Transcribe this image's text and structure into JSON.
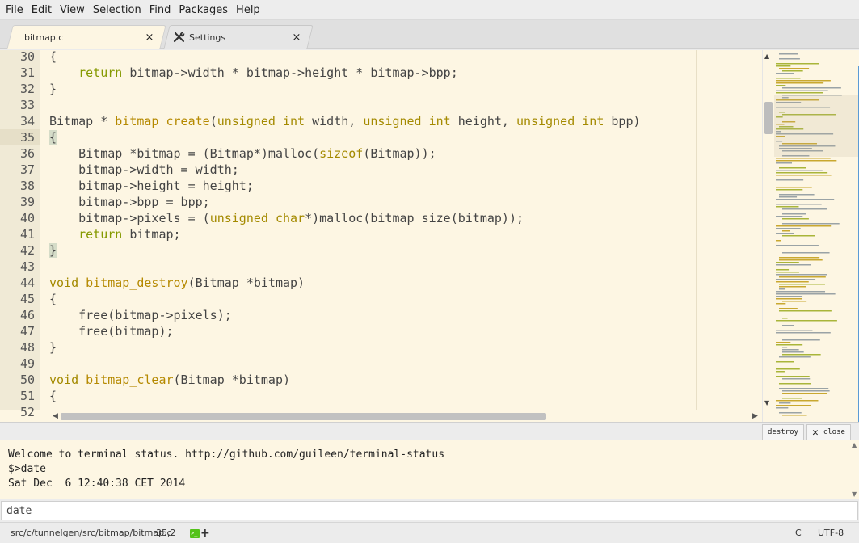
{
  "menu": [
    "File",
    "Edit",
    "View",
    "Selection",
    "Find",
    "Packages",
    "Help"
  ],
  "tabs": [
    {
      "label": "bitmap.c",
      "close": "×"
    },
    {
      "label": "Settings",
      "close": "×"
    }
  ],
  "gutter": {
    "lines": [
      "30",
      "31",
      "32",
      "33",
      "34",
      "35",
      "36",
      "37",
      "38",
      "39",
      "40",
      "41",
      "42",
      "43",
      "44",
      "45",
      "46",
      "47",
      "48",
      "49",
      "50",
      "51",
      "52"
    ],
    "current": "35"
  },
  "code": [
    [
      [
        "p",
        "{"
      ]
    ],
    [
      [
        "p",
        "    "
      ],
      [
        "kw",
        "return"
      ],
      [
        "p",
        " bitmap->width * bitmap->height * bitmap->bpp;"
      ]
    ],
    [
      [
        "p",
        "}"
      ]
    ],
    [
      [
        "p",
        ""
      ]
    ],
    [
      [
        "p",
        "Bitmap * "
      ],
      [
        "fn",
        "bitmap_create"
      ],
      [
        "p",
        "("
      ],
      [
        "ty",
        "unsigned"
      ],
      [
        "p",
        " "
      ],
      [
        "ty",
        "int"
      ],
      [
        "p",
        " width, "
      ],
      [
        "ty",
        "unsigned"
      ],
      [
        "p",
        " "
      ],
      [
        "ty",
        "int"
      ],
      [
        "p",
        " height, "
      ],
      [
        "ty",
        "unsigned"
      ],
      [
        "p",
        " "
      ],
      [
        "ty",
        "int"
      ],
      [
        "p",
        " bpp)"
      ]
    ],
    [
      [
        "hl",
        "{"
      ]
    ],
    [
      [
        "p",
        "    Bitmap *bitmap = (Bitmap*)malloc("
      ],
      [
        "ty",
        "sizeof"
      ],
      [
        "p",
        "(Bitmap));"
      ]
    ],
    [
      [
        "p",
        "    bitmap->width = width;"
      ]
    ],
    [
      [
        "p",
        "    bitmap->height = height;"
      ]
    ],
    [
      [
        "p",
        "    bitmap->bpp = bpp;"
      ]
    ],
    [
      [
        "p",
        "    bitmap->pixels = ("
      ],
      [
        "ty",
        "unsigned"
      ],
      [
        "p",
        " "
      ],
      [
        "ty",
        "char"
      ],
      [
        "p",
        "*)malloc(bitmap_size(bitmap));"
      ]
    ],
    [
      [
        "p",
        "    "
      ],
      [
        "kw",
        "return"
      ],
      [
        "p",
        " bitmap;"
      ]
    ],
    [
      [
        "hl",
        "}"
      ]
    ],
    [
      [
        "p",
        ""
      ]
    ],
    [
      [
        "ty",
        "void"
      ],
      [
        "p",
        " "
      ],
      [
        "fn",
        "bitmap_destroy"
      ],
      [
        "p",
        "(Bitmap *bitmap)"
      ]
    ],
    [
      [
        "p",
        "{"
      ]
    ],
    [
      [
        "p",
        "    free(bitmap->pixels);"
      ]
    ],
    [
      [
        "p",
        "    free(bitmap);"
      ]
    ],
    [
      [
        "p",
        "}"
      ]
    ],
    [
      [
        "p",
        ""
      ]
    ],
    [
      [
        "ty",
        "void"
      ],
      [
        "p",
        " "
      ],
      [
        "fn",
        "bitmap_clear"
      ],
      [
        "p",
        "(Bitmap *bitmap)"
      ]
    ],
    [
      [
        "p",
        "{"
      ]
    ],
    [
      [
        "p",
        ""
      ]
    ]
  ],
  "terminal": {
    "buttons": {
      "destroy": "destroy",
      "close": "close"
    },
    "lines": [
      "Welcome to terminal status. http://github.com/guileen/terminal-status",
      "$>date",
      "Sat Dec  6 12:40:38 CET 2014"
    ],
    "input_value": "date"
  },
  "status": {
    "path": "src/c/tunnelgen/src/bitmap/bitmap.c",
    "cursor": "35,2",
    "term_icon_glyph": ">_",
    "plus": "+",
    "grammar": "C",
    "encoding": "UTF-8"
  },
  "colors": {
    "editor_bg": "#fdf6e3",
    "keyword": "#859900",
    "type": "#a48a00",
    "function": "#b58900",
    "status_terminal": "#53c21a"
  }
}
